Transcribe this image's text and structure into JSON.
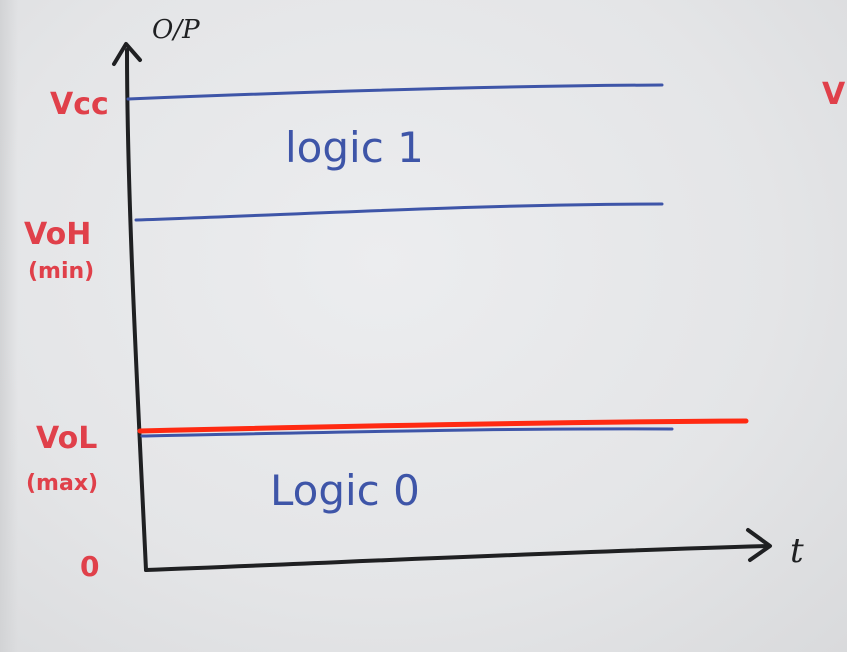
{
  "axes": {
    "y_label": "O/P",
    "x_label": "t",
    "origin_label": "0"
  },
  "levels": {
    "vcc_label": "Vcc",
    "voh_label": "VoH",
    "voh_qualifier": "(min)",
    "vol_label": "VoL",
    "vol_qualifier": "(max)"
  },
  "regions": {
    "logic_high": "logic 1",
    "logic_low": "Logic 0"
  },
  "edge_mark": "V",
  "colors": {
    "ink_black": "#1f2022",
    "ink_blue": "#3e55a8",
    "ink_red": "#e0404a",
    "highlight_red": "#ff2a12"
  }
}
